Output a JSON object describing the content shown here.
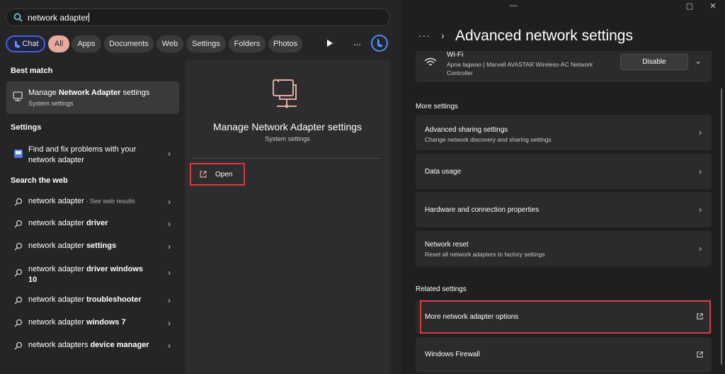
{
  "search": {
    "query": "network adapter",
    "filters": [
      "Chat",
      "All",
      "Apps",
      "Documents",
      "Web",
      "Settings",
      "Folders",
      "Photos"
    ],
    "more": "..."
  },
  "results": {
    "best_match_title": "Best match",
    "best_match": {
      "title_prefix": "Manage ",
      "title_bold": "Network Adapter",
      "title_suffix": " settings",
      "subtitle": "System settings"
    },
    "settings_title": "Settings",
    "settings_item": {
      "line1": "Find and fix problems with your",
      "line2": "network adapter"
    },
    "web_title": "Search the web",
    "web_items": [
      {
        "prefix": "network adapter",
        "bold": "",
        "extra": " - See web results"
      },
      {
        "prefix": "network adapter ",
        "bold": "driver",
        "extra": ""
      },
      {
        "prefix": "network adapter ",
        "bold": "settings",
        "extra": ""
      },
      {
        "prefix": "network adapter ",
        "bold": "driver windows",
        "line2": "10"
      },
      {
        "prefix": "network adapter ",
        "bold": "troubleshooter",
        "extra": ""
      },
      {
        "prefix": "network adapter ",
        "bold": "windows 7",
        "extra": ""
      },
      {
        "prefix": "network adapters ",
        "bold": "device manager",
        "extra": ""
      }
    ]
  },
  "preview": {
    "title": "Manage Network Adapter settings",
    "subtitle": "System settings",
    "open_label": "Open"
  },
  "settings": {
    "page_title": "Advanced network settings",
    "wifi": {
      "name": "Wi-Fi",
      "description": "Apna lagwao | Marvell AVASTAR Wireless-AC Network Controller",
      "disable_label": "Disable"
    },
    "more_settings_title": "More settings",
    "more_settings": [
      {
        "title": "Advanced sharing settings",
        "subtitle": "Change network discovery and sharing settings"
      },
      {
        "title": "Data usage",
        "subtitle": ""
      },
      {
        "title": "Hardware and connection properties",
        "subtitle": ""
      },
      {
        "title": "Network reset",
        "subtitle": "Reset all network adapters to factory settings"
      }
    ],
    "related_title": "Related settings",
    "related": [
      {
        "title": "More network adapter options"
      },
      {
        "title": "Windows Firewall"
      }
    ]
  },
  "colors": {
    "accent_pill": "#e8a99f",
    "highlight": "#d93b3b",
    "chat_border": "#4a5fd8"
  },
  "icons": [
    "search-icon",
    "bing-chat-icon",
    "play-icon",
    "bing-icon",
    "network-settings-icon",
    "troubleshoot-icon",
    "web-search-icon",
    "open-external-icon",
    "wifi-icon",
    "chevron-right-icon",
    "chevron-down-icon",
    "minimize-icon",
    "maximize-icon",
    "close-icon"
  ]
}
